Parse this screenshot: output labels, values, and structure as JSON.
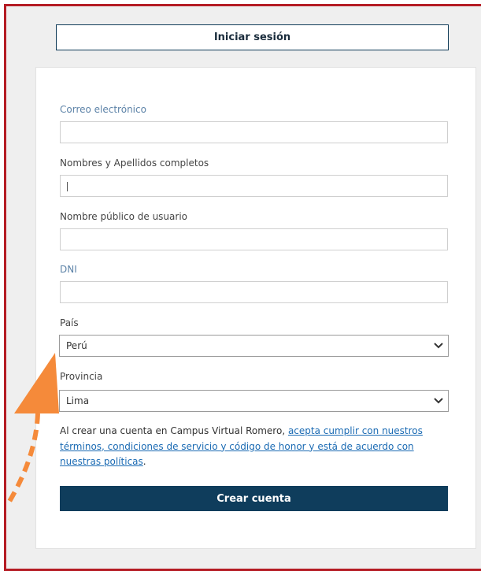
{
  "tab": {
    "label": "Iniciar sesión"
  },
  "form": {
    "email": {
      "label": "Correo electrónico",
      "value": ""
    },
    "full_name": {
      "label": "Nombres y Apellidos completos",
      "value": ""
    },
    "username": {
      "label": "Nombre público de usuario",
      "value": ""
    },
    "dni": {
      "label": "DNI",
      "value": ""
    },
    "country": {
      "label": "País",
      "selected": "Perú"
    },
    "province": {
      "label": "Provincia",
      "selected": "Lima"
    }
  },
  "terms": {
    "prefix": "Al crear una cuenta en Campus Virtual Romero, ",
    "link1": "acepta cumplir con nuestros términos, condiciones de servicio y código de honor y está de acuerdo con nuestras políticas",
    "suffix": "."
  },
  "submit": {
    "label": "Crear cuenta"
  },
  "colors": {
    "frame": "#b51c24",
    "primary": "#0f3d5c",
    "annotation": "#f58a3a",
    "link": "#1a6ab3"
  },
  "icons": {
    "select_chevron": "chevron-down-icon",
    "annotation": "orange-arrow-annotation"
  }
}
